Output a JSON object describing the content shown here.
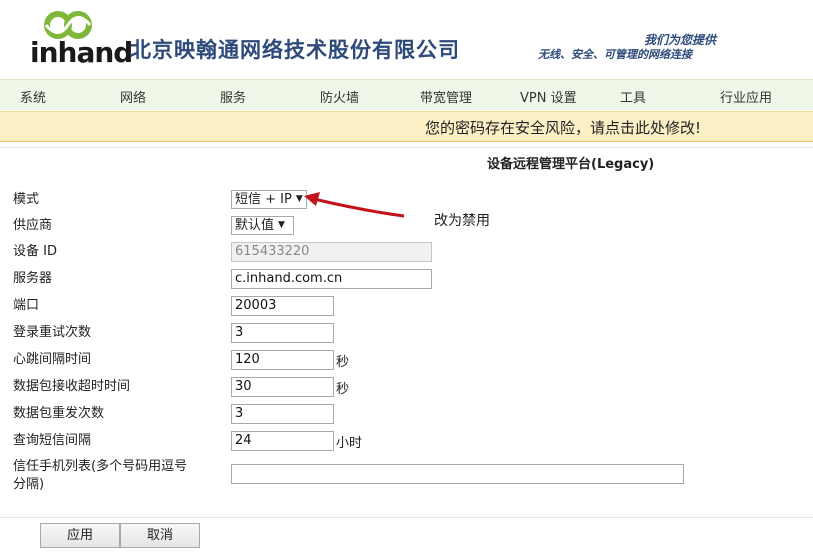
{
  "header": {
    "logo_text": "inhand",
    "company_name": "北京映翰通网络技术股份有限公司",
    "slogan_line1": "我们为您提供",
    "slogan_line2": "无线、安全、可管理的网络连接",
    "brand_color": "#7fb73a"
  },
  "nav": {
    "items": [
      "系统",
      "网络",
      "服务",
      "防火墙",
      "带宽管理",
      "VPN 设置",
      "工具",
      "行业应用"
    ]
  },
  "warning": {
    "text": "您的密码存在安全风险，请点击此处修改!"
  },
  "page": {
    "title": "设备远程管理平台(Legacy)"
  },
  "form": {
    "mode": {
      "label": "模式",
      "value": "短信 + IP"
    },
    "provider": {
      "label": "供应商",
      "value": "默认值"
    },
    "device_id": {
      "label": "设备 ID",
      "value": "615433220"
    },
    "server": {
      "label": "服务器",
      "value": "c.inhand.com.cn"
    },
    "port": {
      "label": "端口",
      "value": "20003"
    },
    "login_retries": {
      "label": "登录重试次数",
      "value": "3"
    },
    "heartbeat": {
      "label": "心跳间隔时间",
      "value": "120",
      "unit": "秒"
    },
    "packet_timeout": {
      "label": "数据包接收超时时间",
      "value": "30",
      "unit": "秒"
    },
    "packet_resend": {
      "label": "数据包重发次数",
      "value": "3"
    },
    "sms_interval": {
      "label": "查询短信间隔",
      "value": "24",
      "unit": "小时"
    },
    "trusted_phones": {
      "label_line1": "信任手机列表(多个号码用逗号",
      "label_line2": "分隔)",
      "value": ""
    }
  },
  "annotation": {
    "note": "改为禁用",
    "arrow_color": "#c0141a"
  },
  "buttons": {
    "apply": "应用",
    "cancel": "取消"
  }
}
